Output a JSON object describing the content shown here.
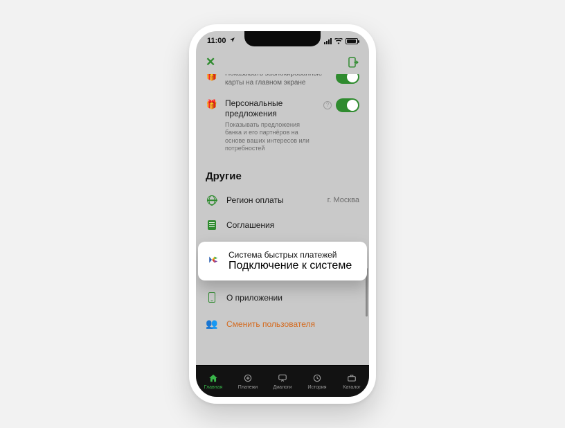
{
  "statusbar": {
    "time": "11:00"
  },
  "settings_upper": [
    {
      "title": "Показывать заблокированные карты на главном экране",
      "desc": "",
      "toggle": true,
      "help": false
    },
    {
      "title": "Персональные предложения",
      "desc": "Показывать предложения банка и его партнёров на основе ваших интересов или потребностей",
      "toggle": true,
      "help": true
    }
  ],
  "section_other_title": "Другие",
  "other_items": {
    "region": {
      "label": "Регион оплаты",
      "value": "г. Москва"
    },
    "agreements": {
      "label": "Соглашения"
    },
    "sbp": {
      "label": "Система быстрых платежей",
      "sub": "Подключение к системе"
    },
    "about": {
      "label": "О приложении"
    },
    "switch_user": {
      "label": "Сменить пользователя"
    }
  },
  "tabs": [
    {
      "label": "Главная"
    },
    {
      "label": "Платежи"
    },
    {
      "label": "Диалоги"
    },
    {
      "label": "История"
    },
    {
      "label": "Каталог"
    }
  ]
}
